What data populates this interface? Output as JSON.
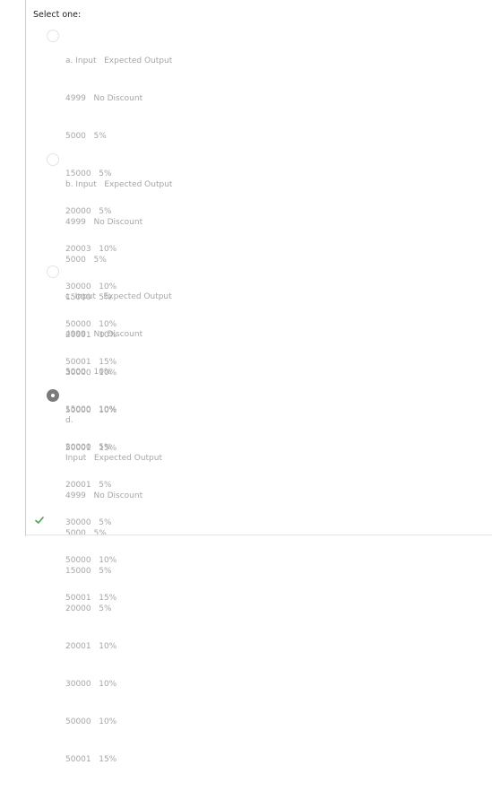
{
  "question": {
    "prompt": "Select one:"
  },
  "options": [
    {
      "letter_line": "a. Input   Expected Output",
      "rows": [
        "4999   No Discount",
        "5000   5%",
        "15000   5%",
        "20000   5%",
        "20003   10%",
        "30000   10%",
        "50000   10%",
        "50001   15%"
      ],
      "selected": false
    },
    {
      "letter_line": "b. Input   Expected Output",
      "rows": [
        "4999   No Discount",
        "5000   5%",
        "15000   5%",
        "20001   10%",
        "30000   10%",
        "50000   10%",
        "50001   15%"
      ],
      "selected": false
    },
    {
      "letter_line": "c. Input   Expected Output",
      "rows": [
        "4999   No Discount",
        "5000   10%",
        "15000   10%",
        "20000   5%",
        "20001   5%",
        "30000   5%",
        "50000   10%",
        "50001   15%"
      ],
      "selected": false
    },
    {
      "letter_line": "d.",
      "rows": [
        "Input   Expected Output",
        "4999   No Discount",
        "5000   5%",
        "15000   5%",
        "20000   5%",
        "20001   10%",
        "30000   10%",
        "50000   10%",
        "50001   15%"
      ],
      "selected": true
    }
  ],
  "feedback": {
    "icon": "checkmark-icon",
    "color": "#4aa34a"
  }
}
